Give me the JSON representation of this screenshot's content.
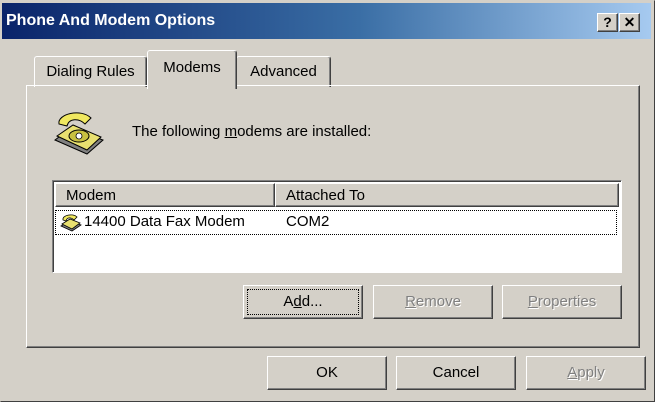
{
  "window": {
    "title": "Phone And Modem Options",
    "help_label": "?",
    "close_label": "✕"
  },
  "tabs": [
    {
      "label": "Dialing Rules",
      "selected": false
    },
    {
      "label": "Modems",
      "selected": true
    },
    {
      "label": "Advanced",
      "selected": false
    }
  ],
  "modems_tab": {
    "installed_text_before": "The following ",
    "installed_text_underlined": "m",
    "installed_text_after": "odems are  installed:",
    "list": {
      "columns": [
        "Modem",
        "Attached To"
      ],
      "rows": [
        {
          "modem": "14400 Data Fax Modem",
          "attached_to": "COM2",
          "icon": "modem-icon"
        }
      ]
    },
    "buttons": {
      "add": {
        "pre": "A",
        "u": "d",
        "post": "d...",
        "enabled": true
      },
      "remove": {
        "pre": "",
        "u": "R",
        "post": "emove",
        "enabled": false
      },
      "properties": {
        "pre": "",
        "u": "P",
        "post": "roperties",
        "enabled": false
      }
    }
  },
  "dialog_buttons": {
    "ok": "OK",
    "cancel": "Cancel",
    "apply": {
      "pre": "",
      "u": "A",
      "post": "pply",
      "enabled": false
    }
  },
  "colors": {
    "title_gradient_start": "#0a246a",
    "title_gradient_end": "#a6caf0",
    "face": "#d4d0c8"
  }
}
